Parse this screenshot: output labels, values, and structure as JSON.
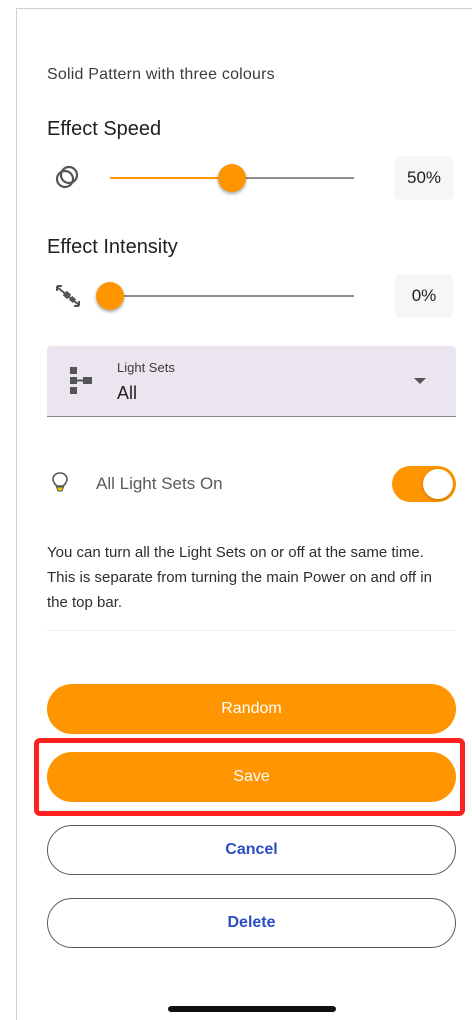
{
  "pattern": {
    "subtitle": "Solid Pattern with three colours"
  },
  "effect_speed": {
    "title": "Effect Speed",
    "value_label": "50%",
    "value": 0.5,
    "icon": "rings-icon"
  },
  "effect_intensity": {
    "title": "Effect Intensity",
    "value_label": "0%",
    "value": 0.0,
    "icon": "intensity-icon"
  },
  "light_sets": {
    "label": "Light Sets",
    "selected": "All",
    "icon": "light-sets-tree-icon"
  },
  "toggle": {
    "label": "All Light Sets On",
    "on": true,
    "icon": "lightbulb-icon"
  },
  "description": "You can turn all the Light Sets on or off at the same time. This is separate from turning the main Power on and off in the top bar.",
  "buttons": {
    "random": "Random",
    "save": "Save",
    "cancel": "Cancel",
    "delete": "Delete"
  },
  "colors": {
    "accent": "#ff9500",
    "link": "#2a4cc4",
    "highlight": "#ff2020",
    "dropdown_bg": "#ebe5f0"
  }
}
